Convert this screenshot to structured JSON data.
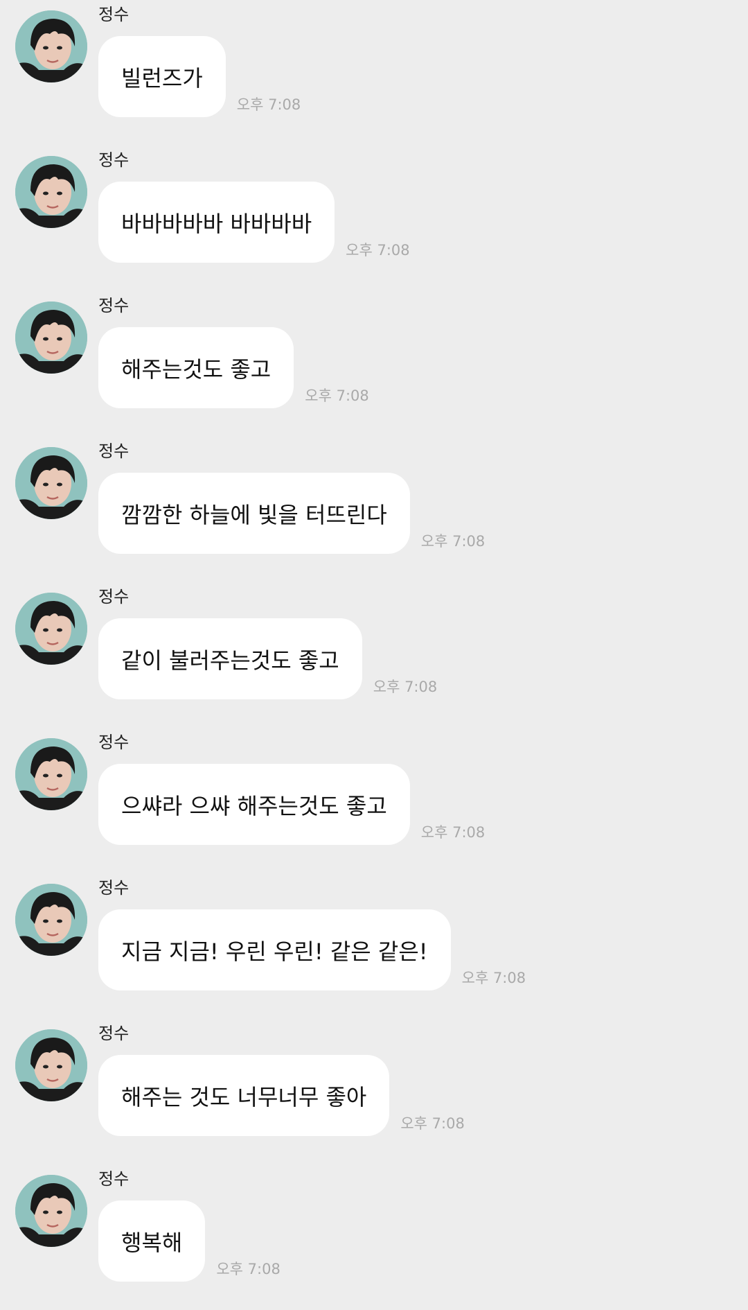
{
  "messages": [
    {
      "sender": "정수",
      "text": "빌런즈가",
      "time": "오후 7:08"
    },
    {
      "sender": "정수",
      "text": "바바바바바 바바바바",
      "time": "오후 7:08"
    },
    {
      "sender": "정수",
      "text": "해주는것도 좋고",
      "time": "오후 7:08"
    },
    {
      "sender": "정수",
      "text": "깜깜한 하늘에 빛을 터뜨린다",
      "time": "오후 7:08"
    },
    {
      "sender": "정수",
      "text": "같이 불러주는것도 좋고",
      "time": "오후 7:08"
    },
    {
      "sender": "정수",
      "text": "으쌰라 으쌰 해주는것도 좋고",
      "time": "오후 7:08"
    },
    {
      "sender": "정수",
      "text": "지금 지금! 우린 우린! 같은 같은!",
      "time": "오후 7:08"
    },
    {
      "sender": "정수",
      "text": "해주는 것도 너무너무 좋아",
      "time": "오후 7:08"
    },
    {
      "sender": "정수",
      "text": "행복해",
      "time": "오후 7:08"
    }
  ],
  "colors": {
    "background": "#ededed",
    "bubble": "#ffffff",
    "timestamp": "#a9a9a9"
  }
}
